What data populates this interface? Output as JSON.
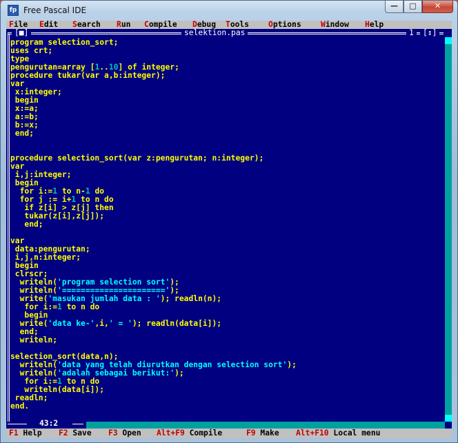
{
  "window": {
    "title": "Free Pascal IDE",
    "icon": "fpc-app-icon",
    "min_glyph": "—",
    "max_glyph": "□",
    "close_glyph": "✕"
  },
  "menu": [
    {
      "hot": "F",
      "rest": "ile"
    },
    {
      "hot": "E",
      "rest": "dit"
    },
    {
      "hot": "S",
      "rest": "earch"
    },
    {
      "hot": "R",
      "rest": "un"
    },
    {
      "hot": "C",
      "rest": "ompile"
    },
    {
      "hot": "D",
      "rest": "ebug"
    },
    {
      "hot": "T",
      "rest": "ools"
    },
    {
      "hot": "O",
      "rest": "ptions"
    },
    {
      "hot": "W",
      "rest": "indow"
    },
    {
      "hot": "H",
      "rest": "elp"
    }
  ],
  "editor": {
    "close_box": "[■]",
    "filename": "selektion.pas",
    "window_number": "1",
    "zoom_box": "[↕]",
    "cursor_pos": "43:2",
    "code_lines": [
      [
        {
          "t": "program selection_sort;"
        }
      ],
      [
        {
          "t": "uses crt;"
        }
      ],
      [
        {
          "t": "type"
        }
      ],
      [
        {
          "t": "pengurutan=array ["
        },
        {
          "t": "1",
          "c": "num"
        },
        {
          "t": ".."
        },
        {
          "t": "10",
          "c": "num"
        },
        {
          "t": "] of integer;"
        }
      ],
      [
        {
          "t": "procedure tukar(var a,b:integer);"
        }
      ],
      [
        {
          "t": "var"
        }
      ],
      [
        {
          "t": " x:integer;"
        }
      ],
      [
        {
          "t": " begin"
        }
      ],
      [
        {
          "t": " x:=a;"
        }
      ],
      [
        {
          "t": " a:=b;"
        }
      ],
      [
        {
          "t": " b:=x;"
        }
      ],
      [
        {
          "t": " end;"
        }
      ],
      [
        {
          "t": ""
        }
      ],
      [
        {
          "t": ""
        }
      ],
      [
        {
          "t": "procedure selection_sort(var z:pengurutan; n:integer);"
        }
      ],
      [
        {
          "t": "var"
        }
      ],
      [
        {
          "t": " i,j:integer;"
        }
      ],
      [
        {
          "t": " begin"
        }
      ],
      [
        {
          "t": "  for i:="
        },
        {
          "t": "1",
          "c": "num"
        },
        {
          "t": " to n-"
        },
        {
          "t": "1",
          "c": "num"
        },
        {
          "t": " do"
        }
      ],
      [
        {
          "t": "  for j := i+"
        },
        {
          "t": "1",
          "c": "num"
        },
        {
          "t": " to n do"
        }
      ],
      [
        {
          "t": "   if z[i] > z[j] then"
        }
      ],
      [
        {
          "t": "   tukar(z[i],z[j]);"
        }
      ],
      [
        {
          "t": "   end;"
        }
      ],
      [
        {
          "t": ""
        }
      ],
      [
        {
          "t": "var"
        }
      ],
      [
        {
          "t": " data:pengurutan;"
        }
      ],
      [
        {
          "t": " i,j,n:integer;"
        }
      ],
      [
        {
          "t": " begin"
        }
      ],
      [
        {
          "t": " clrscr;"
        }
      ],
      [
        {
          "t": "  writeln("
        },
        {
          "t": "'program selection sort'",
          "c": "str"
        },
        {
          "t": ");"
        }
      ],
      [
        {
          "t": "  writeln("
        },
        {
          "t": "'======================'",
          "c": "str"
        },
        {
          "t": ");"
        }
      ],
      [
        {
          "t": "  write("
        },
        {
          "t": "'masukan jumlah data : '",
          "c": "str"
        },
        {
          "t": "); readln(n);"
        }
      ],
      [
        {
          "t": "   for i:="
        },
        {
          "t": "1",
          "c": "num"
        },
        {
          "t": " to n do"
        }
      ],
      [
        {
          "t": "   begin"
        }
      ],
      [
        {
          "t": "  write("
        },
        {
          "t": "'data ke-'",
          "c": "str"
        },
        {
          "t": ",i,"
        },
        {
          "t": "' = '",
          "c": "str"
        },
        {
          "t": "); readln(data[i]);"
        }
      ],
      [
        {
          "t": "  end;"
        }
      ],
      [
        {
          "t": "  writeln;"
        }
      ],
      [
        {
          "t": ""
        }
      ],
      [
        {
          "t": "selection_sort(data,n);"
        }
      ],
      [
        {
          "t": "  writeln("
        },
        {
          "t": "'data yang telah diurutkan dengan selection sort'",
          "c": "str"
        },
        {
          "t": ");"
        }
      ],
      [
        {
          "t": "  writeln("
        },
        {
          "t": "'adalah sebagai berikut:'",
          "c": "str"
        },
        {
          "t": ");"
        }
      ],
      [
        {
          "t": "   for i:="
        },
        {
          "t": "1",
          "c": "num"
        },
        {
          "t": " to n do"
        }
      ],
      [
        {
          "t": "   writeln(data[i]);"
        }
      ],
      [
        {
          "t": " readln;"
        }
      ],
      [
        {
          "t": "end."
        }
      ]
    ]
  },
  "statusbar": [
    {
      "key": "F1",
      "label": "Help"
    },
    {
      "key": "F2",
      "label": "Save"
    },
    {
      "key": "F3",
      "label": "Open"
    },
    {
      "key": "Alt+F9",
      "label": "Compile"
    },
    {
      "key": "F9",
      "label": "Make"
    },
    {
      "key": "Alt+F10",
      "label": "Local menu"
    }
  ],
  "colors": {
    "editor_bg": "#000080",
    "code_text": "#ffff00",
    "numbers": "#00c0c0",
    "strings": "#00ffff",
    "menu_bg": "#c0c0c0",
    "hotkey": "#c00000"
  }
}
